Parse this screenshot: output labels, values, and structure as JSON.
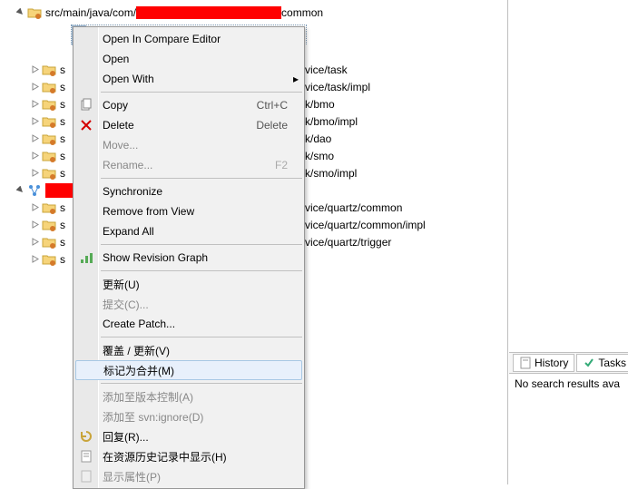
{
  "tree": {
    "root_prefix": "src/main/java/com/",
    "root_suffix": "common",
    "partial_suffixes": [
      "vice/task",
      "vice/task/impl",
      "k/bmo",
      "k/bmo/impl",
      "k/dao",
      "k/smo",
      "k/smo/impl"
    ],
    "branch_suffixes": [
      "vice/quartz/common",
      "vice/quartz/common/impl",
      "vice/quartz/trigger"
    ],
    "stub": "s"
  },
  "menu": {
    "open_compare": "Open In Compare Editor",
    "open": "Open",
    "open_with": "Open With",
    "copy": "Copy",
    "copy_key": "Ctrl+C",
    "delete": "Delete",
    "delete_key": "Delete",
    "move": "Move...",
    "rename": "Rename...",
    "rename_key": "F2",
    "synchronize": "Synchronize",
    "remove_view": "Remove from View",
    "expand_all": "Expand All",
    "show_graph": "Show Revision Graph",
    "update": "更新(U)",
    "commit": "提交(C)...",
    "create_patch": "Create Patch...",
    "override_update": "覆盖 / 更新(V)",
    "mark_merged": "标记为合并(M)",
    "add_vc": "添加至版本控制(A)",
    "add_ignore": "添加至 svn:ignore(D)",
    "revert": "回复(R)...",
    "show_in_history": "在资源历史记录中显示(H)",
    "show_props": "显示属性(P)"
  },
  "right": {
    "tab_history": "History",
    "tab_tasks": "Tasks",
    "no_results": "No search results ava"
  }
}
